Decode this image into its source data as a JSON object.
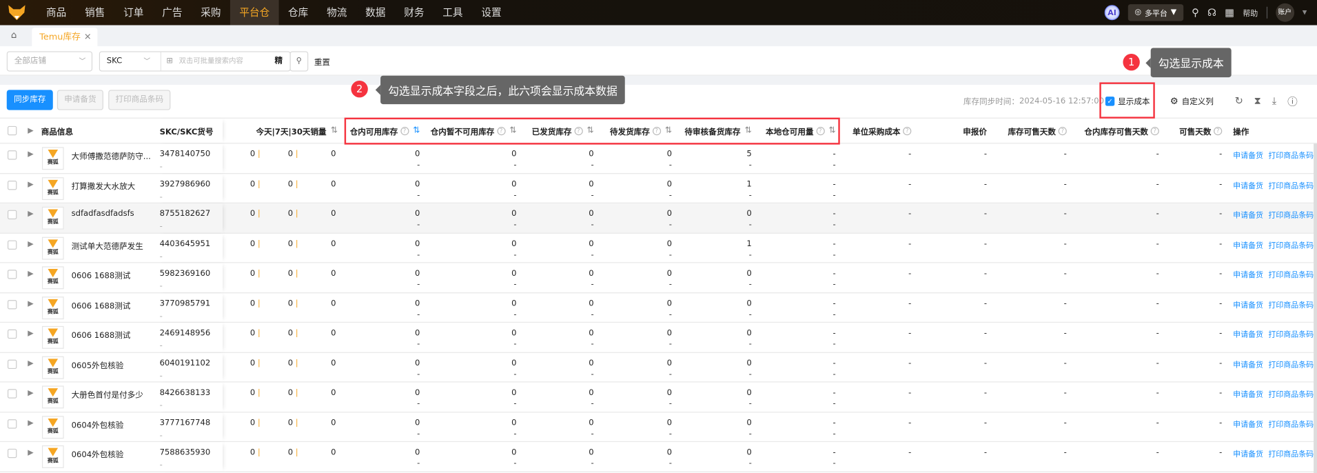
{
  "nav": {
    "menu": [
      "商品",
      "销售",
      "订单",
      "广告",
      "采购",
      "平台仓",
      "仓库",
      "物流",
      "数据",
      "财务",
      "工具",
      "设置"
    ],
    "active_index": 5,
    "ai_label": "AI",
    "platform": "多平台",
    "help": "帮助",
    "account": "账户"
  },
  "tabs": {
    "active": "Temu库存"
  },
  "filter": {
    "shop_select": "全部店铺",
    "field_select": "SKC",
    "search_placeholder": "双击可批量搜索内容",
    "precise": "精",
    "reset": "重置"
  },
  "toolbar": {
    "sync": "同步库存",
    "apply": "申请备货",
    "print": "打印商品条码",
    "sync_time_label": "库存同步时间：",
    "sync_time": "2024-05-16 12:57:00",
    "show_cost": "显示成本",
    "show_cost_checked": true,
    "custom_columns": "自定义列"
  },
  "callouts": [
    {
      "number": "1",
      "text": "勾选显示成本"
    },
    {
      "number": "2",
      "text": "勾选显示成本字段之后，此六项会显示成本数据"
    }
  ],
  "columns": {
    "info": "商品信息",
    "skc": "SKC/SKC货号",
    "sales": "今天|7天|30天销量",
    "avail": "仓内可用库存",
    "unavail": "仓内暂不可用库存",
    "shipped": "已发货库存",
    "pending": "待发货库存",
    "review": "待审核备货库存",
    "local": "本地仓可用量",
    "cost": "单位采购成本",
    "price": "申报价",
    "days_stock": "库存可售天数",
    "days_wh": "仓内库存可售天数",
    "days": "可售天数",
    "ops": "操作"
  },
  "brand": "赛狐",
  "row_actions": {
    "apply": "申请备货",
    "print": "打印商品条码"
  },
  "rows": [
    {
      "name": "大师傅撒范德萨防守...",
      "skc": "3478140750",
      "code": "-",
      "sales": [
        "0",
        "0",
        "0"
      ],
      "avail": [
        "0",
        "-"
      ],
      "unavail": [
        "0",
        "-"
      ],
      "shipped": [
        "0",
        "-"
      ],
      "pending": [
        "0",
        "-"
      ],
      "review": [
        "5",
        "-"
      ],
      "local": [
        "-",
        "-"
      ],
      "cost": "-",
      "price": "-",
      "d1": "-",
      "d2": "-",
      "d3": "-"
    },
    {
      "name": "打算撒发大水放大",
      "skc": "3927986960",
      "code": "-",
      "sales": [
        "0",
        "0",
        "0"
      ],
      "avail": [
        "0",
        "-"
      ],
      "unavail": [
        "0",
        "-"
      ],
      "shipped": [
        "0",
        "-"
      ],
      "pending": [
        "0",
        "-"
      ],
      "review": [
        "1",
        "-"
      ],
      "local": [
        "-",
        "-"
      ],
      "cost": "-",
      "price": "-",
      "d1": "-",
      "d2": "-",
      "d3": "-"
    },
    {
      "name": "sdfadfasdfadsfs",
      "skc": "8755182627",
      "code": "-",
      "sales": [
        "0",
        "0",
        "0"
      ],
      "avail": [
        "0",
        "-"
      ],
      "unavail": [
        "0",
        "-"
      ],
      "shipped": [
        "0",
        "-"
      ],
      "pending": [
        "0",
        "-"
      ],
      "review": [
        "0",
        "-"
      ],
      "local": [
        "-",
        "-"
      ],
      "cost": "-",
      "price": "-",
      "d1": "-",
      "d2": "-",
      "d3": "-"
    },
    {
      "name": "测试单大范德萨发生",
      "skc": "4403645951",
      "code": "-",
      "sales": [
        "0",
        "0",
        "0"
      ],
      "avail": [
        "0",
        "-"
      ],
      "unavail": [
        "0",
        "-"
      ],
      "shipped": [
        "0",
        "-"
      ],
      "pending": [
        "0",
        "-"
      ],
      "review": [
        "1",
        "-"
      ],
      "local": [
        "-",
        "-"
      ],
      "cost": "-",
      "price": "-",
      "d1": "-",
      "d2": "-",
      "d3": "-"
    },
    {
      "name": "0606 1688测试",
      "skc": "5982369160",
      "code": "-",
      "sales": [
        "0",
        "0",
        "0"
      ],
      "avail": [
        "0",
        "-"
      ],
      "unavail": [
        "0",
        "-"
      ],
      "shipped": [
        "0",
        "-"
      ],
      "pending": [
        "0",
        "-"
      ],
      "review": [
        "0",
        "-"
      ],
      "local": [
        "-",
        "-"
      ],
      "cost": "-",
      "price": "-",
      "d1": "-",
      "d2": "-",
      "d3": "-"
    },
    {
      "name": "0606 1688测试",
      "skc": "3770985791",
      "code": "-",
      "sales": [
        "0",
        "0",
        "0"
      ],
      "avail": [
        "0",
        "-"
      ],
      "unavail": [
        "0",
        "-"
      ],
      "shipped": [
        "0",
        "-"
      ],
      "pending": [
        "0",
        "-"
      ],
      "review": [
        "0",
        "-"
      ],
      "local": [
        "-",
        "-"
      ],
      "cost": "-",
      "price": "-",
      "d1": "-",
      "d2": "-",
      "d3": "-"
    },
    {
      "name": "0606 1688测试",
      "skc": "2469148956",
      "code": "-",
      "sales": [
        "0",
        "0",
        "0"
      ],
      "avail": [
        "0",
        "-"
      ],
      "unavail": [
        "0",
        "-"
      ],
      "shipped": [
        "0",
        "-"
      ],
      "pending": [
        "0",
        "-"
      ],
      "review": [
        "0",
        "-"
      ],
      "local": [
        "-",
        "-"
      ],
      "cost": "-",
      "price": "-",
      "d1": "-",
      "d2": "-",
      "d3": "-"
    },
    {
      "name": "0605外包核验",
      "skc": "6040191102",
      "code": "-",
      "sales": [
        "0",
        "0",
        "0"
      ],
      "avail": [
        "0",
        "-"
      ],
      "unavail": [
        "0",
        "-"
      ],
      "shipped": [
        "0",
        "-"
      ],
      "pending": [
        "0",
        "-"
      ],
      "review": [
        "0",
        "-"
      ],
      "local": [
        "-",
        "-"
      ],
      "cost": "-",
      "price": "-",
      "d1": "-",
      "d2": "-",
      "d3": "-"
    },
    {
      "name": "大册色首付是付多少",
      "skc": "8426638133",
      "code": "-",
      "sales": [
        "0",
        "0",
        "0"
      ],
      "avail": [
        "0",
        "-"
      ],
      "unavail": [
        "0",
        "-"
      ],
      "shipped": [
        "0",
        "-"
      ],
      "pending": [
        "0",
        "-"
      ],
      "review": [
        "0",
        "-"
      ],
      "local": [
        "-",
        "-"
      ],
      "cost": "-",
      "price": "-",
      "d1": "-",
      "d2": "-",
      "d3": "-"
    },
    {
      "name": "0604外包核验",
      "skc": "3777167748",
      "code": "-",
      "sales": [
        "0",
        "0",
        "0"
      ],
      "avail": [
        "0",
        "-"
      ],
      "unavail": [
        "0",
        "-"
      ],
      "shipped": [
        "0",
        "-"
      ],
      "pending": [
        "0",
        "-"
      ],
      "review": [
        "0",
        "-"
      ],
      "local": [
        "-",
        "-"
      ],
      "cost": "-",
      "price": "-",
      "d1": "-",
      "d2": "-",
      "d3": "-"
    },
    {
      "name": "0604外包核验",
      "skc": "7588635930",
      "code": "-",
      "sales": [
        "0",
        "0",
        "0"
      ],
      "avail": [
        "0",
        "-"
      ],
      "unavail": [
        "0",
        "-"
      ],
      "shipped": [
        "0",
        "-"
      ],
      "pending": [
        "0",
        "-"
      ],
      "review": [
        "0",
        "-"
      ],
      "local": [
        "-",
        "-"
      ],
      "cost": "-",
      "price": "-",
      "d1": "-",
      "d2": "-",
      "d3": "-"
    }
  ],
  "highlight_row": 2,
  "colors": {
    "accent": "#f5a623",
    "primary": "#1890ff",
    "callout": "#f5333f"
  }
}
